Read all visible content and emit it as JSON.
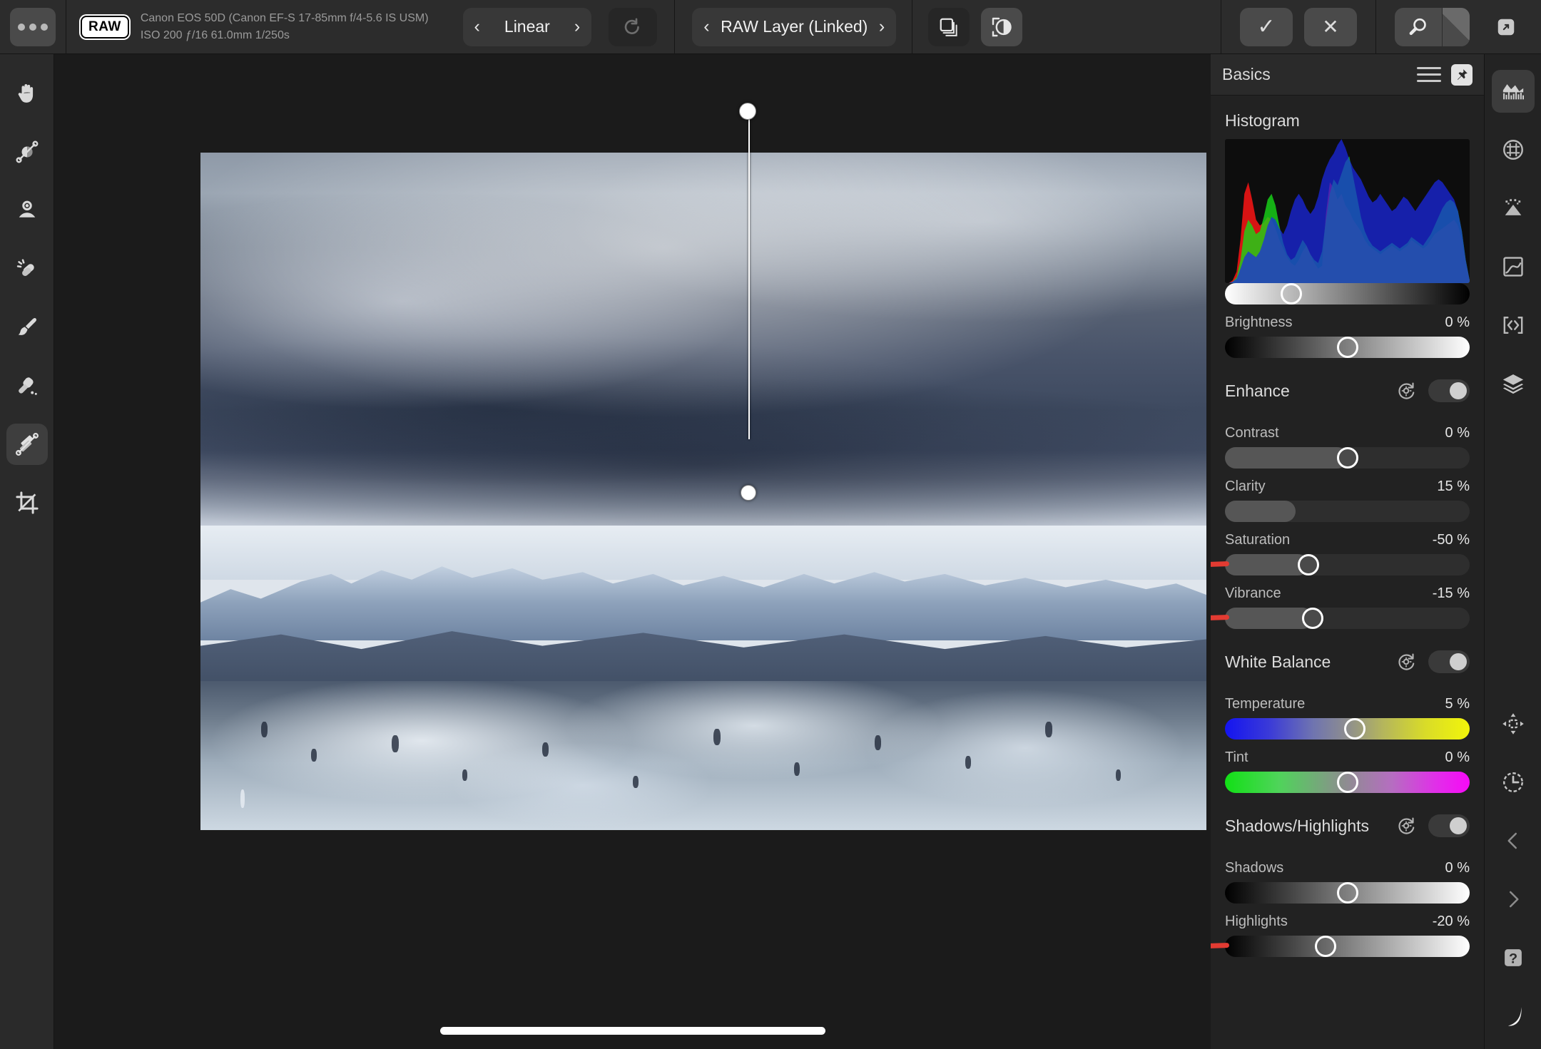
{
  "topbar": {
    "more_label": "•••",
    "raw_badge": "RAW",
    "camera_line1": "Canon EOS 50D (Canon EF-S 17-85mm f/4-5.6 IS USM)",
    "camera_line2": "ISO 200 ƒ/16 61.0mm 1/250s",
    "profile_label": "Linear",
    "prev_arrow": "‹",
    "next_arrow": "›",
    "reset_icon": "undo-icon",
    "layer_label": "RAW Layer (Linked)",
    "copies_icon": "duplicate-layers-icon",
    "compare_icon": "before-after-icon",
    "apply_label": "✓",
    "cancel_label": "✕",
    "zoom_icon": "magnifier-icon",
    "expand_icon": "expand-panel-icon"
  },
  "left_tools": [
    {
      "name": "hand-tool",
      "label": "Hand",
      "active": false
    },
    {
      "name": "white-balance-tool",
      "label": "White Balance Picker",
      "active": false
    },
    {
      "name": "overlay-paint-tool",
      "label": "Overlay Paint",
      "active": false
    },
    {
      "name": "blemish-removal-tool",
      "label": "Blemish Removal",
      "active": false
    },
    {
      "name": "paint-brush-tool",
      "label": "Paint Brush",
      "active": false
    },
    {
      "name": "inpainting-tool",
      "label": "Inpainting Brush",
      "active": false
    },
    {
      "name": "gradient-tool",
      "label": "Gradient",
      "active": true
    },
    {
      "name": "crop-tool",
      "label": "Crop",
      "active": false
    }
  ],
  "panel": {
    "title": "Basics",
    "menu_icon": "hamburger-menu-icon",
    "pin_icon": "pin-icon",
    "histogram_title": "Histogram",
    "sections": [
      {
        "id": "blackpoint",
        "type": "bare-slider",
        "slider": {
          "name": "Black Point",
          "value": "",
          "pos": 27,
          "style": "white-to-black"
        }
      },
      {
        "id": "brightness",
        "type": "bare-slider",
        "slider": {
          "name": "Brightness",
          "value": "0 %",
          "pos": 50,
          "style": "black-to-white"
        }
      },
      {
        "id": "enhance",
        "type": "section",
        "name": "Enhance",
        "reset_icon": "reset-icon",
        "enabled": true,
        "sliders": [
          {
            "name": "Contrast",
            "value": "0 %",
            "pos": 50,
            "style": "fill",
            "knob": true,
            "marked": false
          },
          {
            "name": "Clarity",
            "value": "15 %",
            "pos": 29,
            "style": "fill",
            "knob": false,
            "marked": false
          },
          {
            "name": "Saturation",
            "value": "-50 %",
            "pos": 34,
            "style": "fill",
            "knob": true,
            "marked": true
          },
          {
            "name": "Vibrance",
            "value": "-15 %",
            "pos": 36,
            "style": "fill",
            "knob": true,
            "marked": true
          }
        ]
      },
      {
        "id": "white-balance",
        "type": "section",
        "name": "White Balance",
        "reset_icon": "reset-icon",
        "enabled": true,
        "sliders": [
          {
            "name": "Temperature",
            "value": "5 %",
            "pos": 53,
            "style": "wb-gradient",
            "knob": true,
            "marked": false
          },
          {
            "name": "Tint",
            "value": "0 %",
            "pos": 50,
            "style": "tint-gradient",
            "knob": true,
            "marked": false
          }
        ]
      },
      {
        "id": "shadows-highlights",
        "type": "section",
        "name": "Shadows/Highlights",
        "reset_icon": "reset-icon",
        "enabled": true,
        "sliders": [
          {
            "name": "Shadows",
            "value": "0 %",
            "pos": 50,
            "style": "black-to-white",
            "knob": true,
            "marked": false
          },
          {
            "name": "Highlights",
            "value": "-20 %",
            "pos": 41,
            "style": "black-to-white",
            "knob": true,
            "marked": true
          }
        ]
      }
    ]
  },
  "right_rail_top": [
    {
      "name": "histogram-panel-icon",
      "label": "Histogram",
      "active": true
    },
    {
      "name": "lens-correction-icon",
      "label": "Lens Corrections",
      "active": false
    },
    {
      "name": "details-noise-icon",
      "label": "Details",
      "active": false
    },
    {
      "name": "tone-curve-icon",
      "label": "Tone Curve",
      "active": false
    },
    {
      "name": "overlays-icon",
      "label": "Overlays",
      "active": false
    },
    {
      "name": "layers-icon",
      "label": "Layers",
      "active": false
    }
  ],
  "right_rail_bottom": [
    {
      "name": "transform-move-icon",
      "label": "Transform",
      "active": false
    },
    {
      "name": "history-clock-icon",
      "label": "History",
      "active": false
    },
    {
      "name": "previous-image-icon",
      "label": "Previous",
      "active": false
    },
    {
      "name": "next-image-icon",
      "label": "Next",
      "active": false
    },
    {
      "name": "help-icon",
      "label": "?",
      "active": false
    },
    {
      "name": "curve-swoosh-icon",
      "label": "Assistant",
      "active": false
    }
  ],
  "canvas": {
    "gradient_overlay": {
      "start_handle": "gradient-start-handle",
      "end_handle": "gradient-end-handle"
    },
    "home_indicator": "home-indicator"
  },
  "colors": {
    "accent_red": "#e23b32",
    "panel_bg": "#222222",
    "toolbar_bg": "#2c2c2c",
    "canvas_bg": "#1b1b1b",
    "knob": "#ffffff"
  },
  "chart_data": {
    "type": "area",
    "title": "Histogram",
    "channels": [
      "red",
      "green",
      "blue"
    ],
    "bins": 64,
    "red": [
      0,
      0,
      2,
      8,
      30,
      62,
      70,
      58,
      44,
      40,
      42,
      46,
      44,
      38,
      30,
      24,
      18,
      14,
      12,
      16,
      22,
      26,
      20,
      14,
      10,
      12,
      48,
      70,
      66,
      58,
      62,
      54,
      50,
      44,
      40,
      36,
      30,
      26,
      24,
      22,
      20,
      22,
      24,
      26,
      24,
      22,
      24,
      26,
      30,
      28,
      26,
      24,
      26,
      30,
      34,
      36,
      38,
      40,
      42,
      44,
      40,
      30,
      14,
      2
    ],
    "green": [
      0,
      0,
      1,
      4,
      16,
      36,
      44,
      40,
      34,
      36,
      46,
      58,
      62,
      54,
      40,
      28,
      20,
      16,
      18,
      24,
      30,
      26,
      20,
      16,
      14,
      22,
      44,
      62,
      72,
      68,
      76,
      84,
      88,
      74,
      60,
      46,
      36,
      30,
      26,
      24,
      22,
      24,
      26,
      28,
      26,
      24,
      26,
      28,
      32,
      30,
      28,
      26,
      30,
      34,
      40,
      46,
      52,
      56,
      58,
      56,
      50,
      36,
      16,
      2
    ],
    "blue": [
      0,
      0,
      1,
      3,
      10,
      18,
      22,
      20,
      18,
      22,
      30,
      40,
      46,
      44,
      38,
      34,
      40,
      50,
      58,
      62,
      58,
      52,
      48,
      52,
      60,
      72,
      80,
      86,
      90,
      96,
      100,
      94,
      86,
      80,
      76,
      72,
      66,
      60,
      56,
      58,
      62,
      58,
      54,
      50,
      52,
      56,
      60,
      58,
      54,
      50,
      54,
      58,
      62,
      66,
      70,
      72,
      70,
      66,
      62,
      58,
      50,
      36,
      16,
      2
    ],
    "xlabel": "",
    "ylabel": "",
    "grid": false,
    "legend": false
  }
}
